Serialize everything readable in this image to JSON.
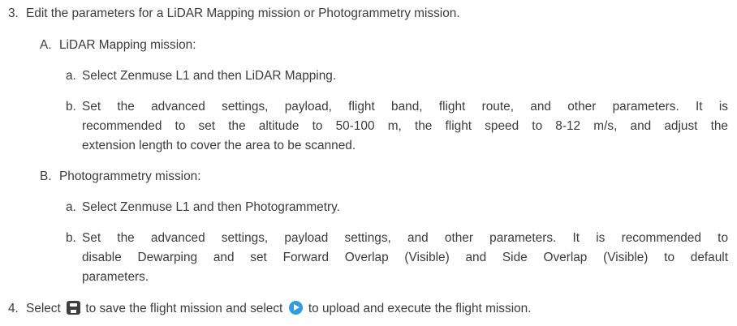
{
  "steps": [
    {
      "number": "3.",
      "text": "Edit the parameters for a LiDAR Mapping mission or Photogrammetry mission."
    },
    {
      "number": "4.",
      "text_before_save": "Select",
      "save_icon": "save-icon",
      "text_between": "to save the flight mission and select",
      "play_icon": "play-upload-icon",
      "text_after_play": "to upload and execute the flight mission.",
      "play_icon_color": "#2f9ee0"
    }
  ],
  "sections": {
    "A": {
      "letter": "A.",
      "title": "LiDAR Mapping mission:",
      "a": {
        "letter": "a.",
        "text": "Select Zenmuse L1 and then LiDAR Mapping."
      },
      "b": {
        "letter": "b.",
        "lines": [
          "Set the advanced settings, payload, flight band, flight route, and other parameters. It is",
          "recommended to set the altitude to 50-100 m, the flight speed to 8-12 m/s, and adjust the",
          "extension length to cover the area to be scanned."
        ]
      }
    },
    "B": {
      "letter": "B.",
      "title": "Photogrammetry mission:",
      "a": {
        "letter": "a.",
        "text": "Select Zenmuse L1 and then Photogrammetry."
      },
      "b": {
        "letter": "b.",
        "lines": [
          "Set the advanced settings, payload settings, and other parameters. It is recommended to",
          "disable Dewarping and set Forward Overlap (Visible) and Side Overlap (Visible) to default",
          "parameters."
        ]
      }
    }
  }
}
